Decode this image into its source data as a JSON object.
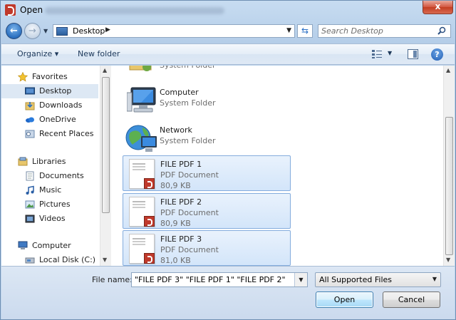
{
  "window": {
    "title": "Open",
    "close_label": "x"
  },
  "nav": {
    "back_icon": "back-arrow-icon",
    "forward_icon": "forward-arrow-icon",
    "address_location": "Desktop",
    "search_placeholder": "Search Desktop"
  },
  "toolbar": {
    "organize_label": "Organize ▾",
    "new_folder_label": "New folder",
    "help_label": "?"
  },
  "sidebar": {
    "items": [
      {
        "label": "Favorites",
        "icon": "star-icon"
      },
      {
        "label": "Desktop",
        "icon": "desktop-icon",
        "selected": true
      },
      {
        "label": "Downloads",
        "icon": "downloads-icon"
      },
      {
        "label": "OneDrive",
        "icon": "onedrive-icon"
      },
      {
        "label": "Recent Places",
        "icon": "recent-places-icon"
      },
      {
        "label": "Libraries",
        "icon": "libraries-icon"
      },
      {
        "label": "Documents",
        "icon": "documents-icon"
      },
      {
        "label": "Music",
        "icon": "music-icon"
      },
      {
        "label": "Pictures",
        "icon": "pictures-icon"
      },
      {
        "label": "Videos",
        "icon": "videos-icon"
      },
      {
        "label": "Computer",
        "icon": "computer-icon"
      },
      {
        "label": "Local Disk (C:)",
        "icon": "disk-icon"
      }
    ]
  },
  "files": {
    "partial_top_type": "System Folder",
    "items": [
      {
        "name": "Computer",
        "type": "System Folder",
        "icon": "computer-icon"
      },
      {
        "name": "Network",
        "type": "System Folder",
        "icon": "network-icon"
      },
      {
        "name": "FILE PDF 1",
        "type": "PDF Document",
        "size": "80,9 KB",
        "selected": true
      },
      {
        "name": "FILE PDF 2",
        "type": "PDF Document",
        "size": "80,9 KB",
        "selected": true
      },
      {
        "name": "FILE PDF 3",
        "type": "PDF Document",
        "size": "81,0 KB",
        "selected": true
      }
    ]
  },
  "footer": {
    "file_name_label": "File name:",
    "file_name_value": "\"FILE PDF 3\" \"FILE PDF 1\" \"FILE PDF 2\"",
    "filter_value": "All Supported Files",
    "open_label": "Open",
    "cancel_label": "Cancel"
  },
  "colors": {
    "accent": "#2b6fbf",
    "selection": "#d3e5fa",
    "pdf_badge": "#c0392b"
  }
}
